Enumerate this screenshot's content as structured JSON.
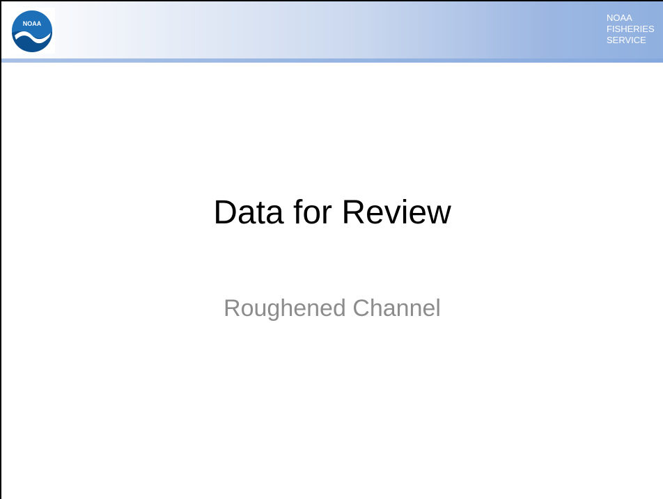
{
  "header": {
    "logo_text": "NOAA",
    "org_lines": [
      "NOAA",
      "FISHERIES",
      "SERVICE"
    ]
  },
  "slide": {
    "title": "Data for Review",
    "subtitle": "Roughened Channel"
  },
  "colors": {
    "banner_start": "#ffffff",
    "banner_end": "#8fb0e0",
    "logo_blue": "#1d6fb8",
    "subtitle_gray": "#8c8c8c"
  }
}
